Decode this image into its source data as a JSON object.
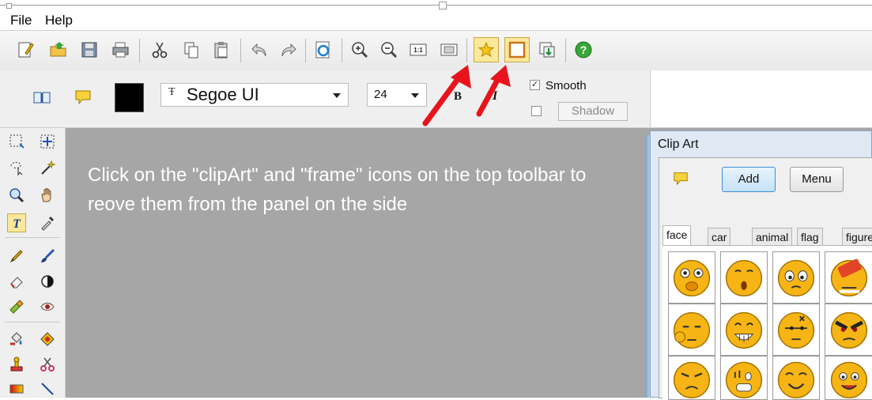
{
  "menu": {
    "file": "File",
    "help": "Help"
  },
  "toolbar": {
    "icons": [
      "new-icon",
      "open-icon",
      "save-icon",
      "print-icon",
      "cut-icon",
      "copy-icon",
      "paste-icon",
      "undo-icon",
      "redo-icon",
      "refresh-icon",
      "zoom-in-icon",
      "zoom-out-icon",
      "actual-size-icon",
      "fit-icon",
      "clipart-icon",
      "frame-icon",
      "import-icon",
      "help-icon"
    ],
    "actual_size_label": "1:1"
  },
  "props": {
    "font_name": "Segoe UI",
    "font_size": "24",
    "bold_label": "B",
    "italic_label": "I",
    "smooth_label": "Smooth",
    "smooth_checked": true,
    "shadow_label": "Shadow",
    "shadow_checked": false,
    "color": "#000000"
  },
  "instruction": "Click on the \"clipArt\" and \"frame\" icons on the top toolbar to reove them from the panel on the side",
  "clipart": {
    "title": "Clip Art",
    "add_label": "Add",
    "menu_label": "Menu",
    "tabs": [
      "face",
      "car",
      "animal",
      "flag",
      "figure"
    ],
    "selected_tab": "face"
  },
  "colors": {
    "canvas": "#a6a6a6",
    "arrow": "#e8141c",
    "smiley": "#f6b514"
  }
}
